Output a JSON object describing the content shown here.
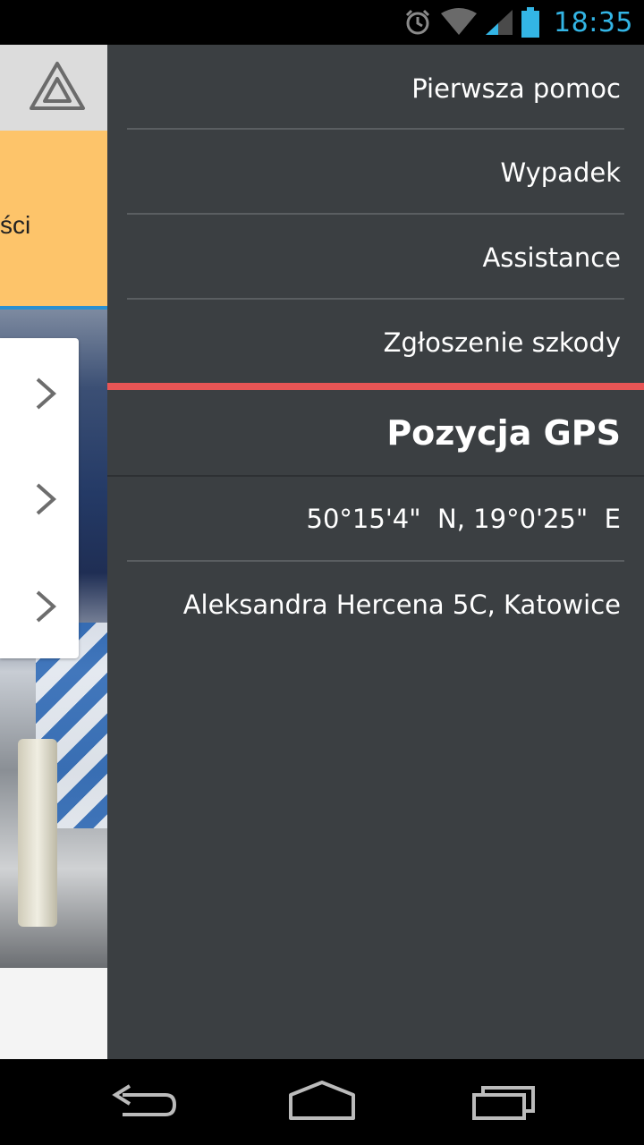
{
  "status_bar": {
    "time": "18:35",
    "icons": [
      "alarm-icon",
      "wifi-icon",
      "signal-icon",
      "battery-icon"
    ]
  },
  "background_screen": {
    "partial_text": "ści",
    "colors": {
      "orange_banner": "#fdc46a",
      "accent_line": "#2a8fd0"
    }
  },
  "drawer": {
    "menu_items": [
      {
        "label": "Pierwsza pomoc"
      },
      {
        "label": "Wypadek"
      },
      {
        "label": "Assistance"
      },
      {
        "label": "Zgłoszenie szkody"
      }
    ],
    "gps": {
      "title": "Pozycja GPS",
      "coordinates": "50°15'4\"  N, 19°0'25\"  E",
      "address": "Aleksandra Hercena 5C, Katowice"
    },
    "colors": {
      "background": "#3b3f42",
      "separator_accent": "#e85555"
    }
  },
  "nav_bar": {
    "buttons": [
      "back-icon",
      "home-icon",
      "recent-apps-icon"
    ]
  }
}
